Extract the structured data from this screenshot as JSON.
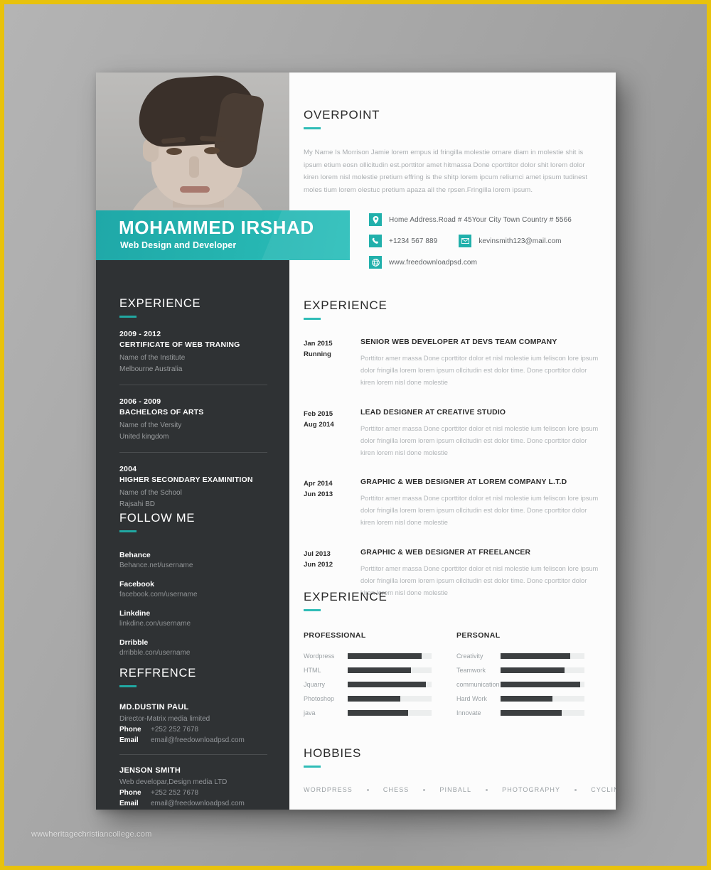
{
  "backdrop": {
    "watermark": "wwwheritagechristiancollege.com",
    "frame_color": "#e8c20c",
    "bg_color": "#a6a6a6"
  },
  "theme": {
    "teal": "#21b0ab",
    "dark": "#2f3234",
    "paper": "#fcfcfc"
  },
  "banner": {
    "name": "MOHAMMED IRSHAD",
    "role": "Web Design and Developer"
  },
  "about": {
    "heading": "OVERPOINT",
    "body": "My Name Is Morrison Jamie lorem empus id fringilla molestie ornare diam in molestie shit is ipsum etium eosn ollicitudin est.porttitor amet hitmassa Done cporttitor dolor shit lorem dolor kiren lorem nisl molestie pretium effring is the shitp lorem ipcum reliumci amet ipsum tudinest moles tium lorem olestuc pretium apaza all the rpsen.Fringilla lorem ipsum."
  },
  "contact": {
    "address": "Home Address.Road # 45Your City Town Country # 5566",
    "phone": "+1234 567 889",
    "email": "kevinsmith123@mail.com",
    "website": "www.freedownloadpsd.com",
    "icons": {
      "address": "location-pin-icon",
      "phone": "phone-icon",
      "email": "envelope-icon",
      "website": "globe-icon"
    }
  },
  "education": {
    "heading": "EXPERIENCE",
    "items": [
      {
        "years": "2009 - 2012",
        "title": "CERTIFICATE OF WEB TRANING",
        "line1": "Name of the Institute",
        "line2": "Melbourne Australia"
      },
      {
        "years": "2006 - 2009",
        "title": "BACHELORS OF ARTS",
        "line1": "Name of the Versity",
        "line2": "United kingdom"
      },
      {
        "years": "2004",
        "title": "HIGHER SECONDARY EXAMINITION",
        "line1": "Name of the School",
        "line2": "Rajsahi BD"
      }
    ]
  },
  "follow": {
    "heading": "FOLLOW ME",
    "items": [
      {
        "name": "Behance",
        "url": "Behance.net/username"
      },
      {
        "name": "Facebook",
        "url": "facebook.com/username"
      },
      {
        "name": "Linkdine",
        "url": "linkdine.con/username"
      },
      {
        "name": "Drribble",
        "url": "drribble.con/username"
      }
    ]
  },
  "reference": {
    "heading": "REFFRENCE",
    "phone_label": "Phone",
    "email_label": "Email",
    "items": [
      {
        "name": "MD.DUSTIN PAUL",
        "role": "Director-Matrix media limited",
        "phone": "+252 252 7678",
        "email": "email@freedownloadpsd.com"
      },
      {
        "name": "JENSON SMITH",
        "role": "Web developar,Design media LTD",
        "phone": "+252 252 7678",
        "email": "email@freedownloadpsd.com"
      }
    ]
  },
  "experience": {
    "heading": "EXPERIENCE",
    "items": [
      {
        "date_from": "Jan 2015",
        "date_to": "Running",
        "title": "SENIOR WEB DEVELOPER AT DEVS TEAM COMPANY",
        "desc": "Porttitor amer massa Done cporttitor dolor et nisl molestie ium feliscon lore ipsum dolor fringilla lorem lorem ipsum ollcitudin est dolor time. Done cporttitor dolor kiren lorem nisl done molestie"
      },
      {
        "date_from": "Feb 2015",
        "date_to": "Aug 2014",
        "title": "LEAD DESIGNER AT CREATIVE STUDIO",
        "desc": "Porttitor amer massa Done cporttitor dolor et nisl molestie ium feliscon lore ipsum dolor fringilla lorem lorem ipsum ollcitudin est dolor time. Done cporttitor dolor kiren lorem nisl done molestie"
      },
      {
        "date_from": "Apr 2014",
        "date_to": "Jun 2013",
        "title": "GRAPHIC & WEB DESIGNER AT LOREM COMPANY L.T.D",
        "desc": "Porttitor amer massa Done cporttitor dolor et nisl molestie ium feliscon lore ipsum dolor fringilla lorem lorem ipsum ollcitudin est dolor time. Done cporttitor dolor kiren lorem nisl done molestie"
      },
      {
        "date_from": "Jul 2013",
        "date_to": "Jun 2012",
        "title": "GRAPHIC & WEB DESIGNER AT FREELANCER",
        "desc": "Porttitor amer massa Done cporttitor dolor et nisl molestie ium feliscon lore ipsum dolor fringilla lorem lorem ipsum ollcitudin est dolor time. Done cporttitor dolor kiren lorem nisl done molestie"
      }
    ]
  },
  "skills": {
    "heading": "EXPERIENCE",
    "professional": {
      "label": "PROFESSIONAL",
      "items": [
        {
          "name": "Wordpress",
          "value": 88
        },
        {
          "name": "HTML",
          "value": 75
        },
        {
          "name": "Jquarry",
          "value": 93
        },
        {
          "name": "Photoshop",
          "value": 63
        },
        {
          "name": "java",
          "value": 72
        }
      ]
    },
    "personal": {
      "label": "PERSONAL",
      "items": [
        {
          "name": "Creativity",
          "value": 83
        },
        {
          "name": "Teamwork",
          "value": 76
        },
        {
          "name": "communication",
          "value": 95
        },
        {
          "name": "Hard Work",
          "value": 62
        },
        {
          "name": "Innovate",
          "value": 73
        }
      ]
    }
  },
  "hobbies": {
    "heading": "HOBBIES",
    "items": [
      "WORDPRESS",
      "CHESS",
      "PINBALL",
      "PHOTOGRAPHY",
      "CYCLING"
    ]
  }
}
